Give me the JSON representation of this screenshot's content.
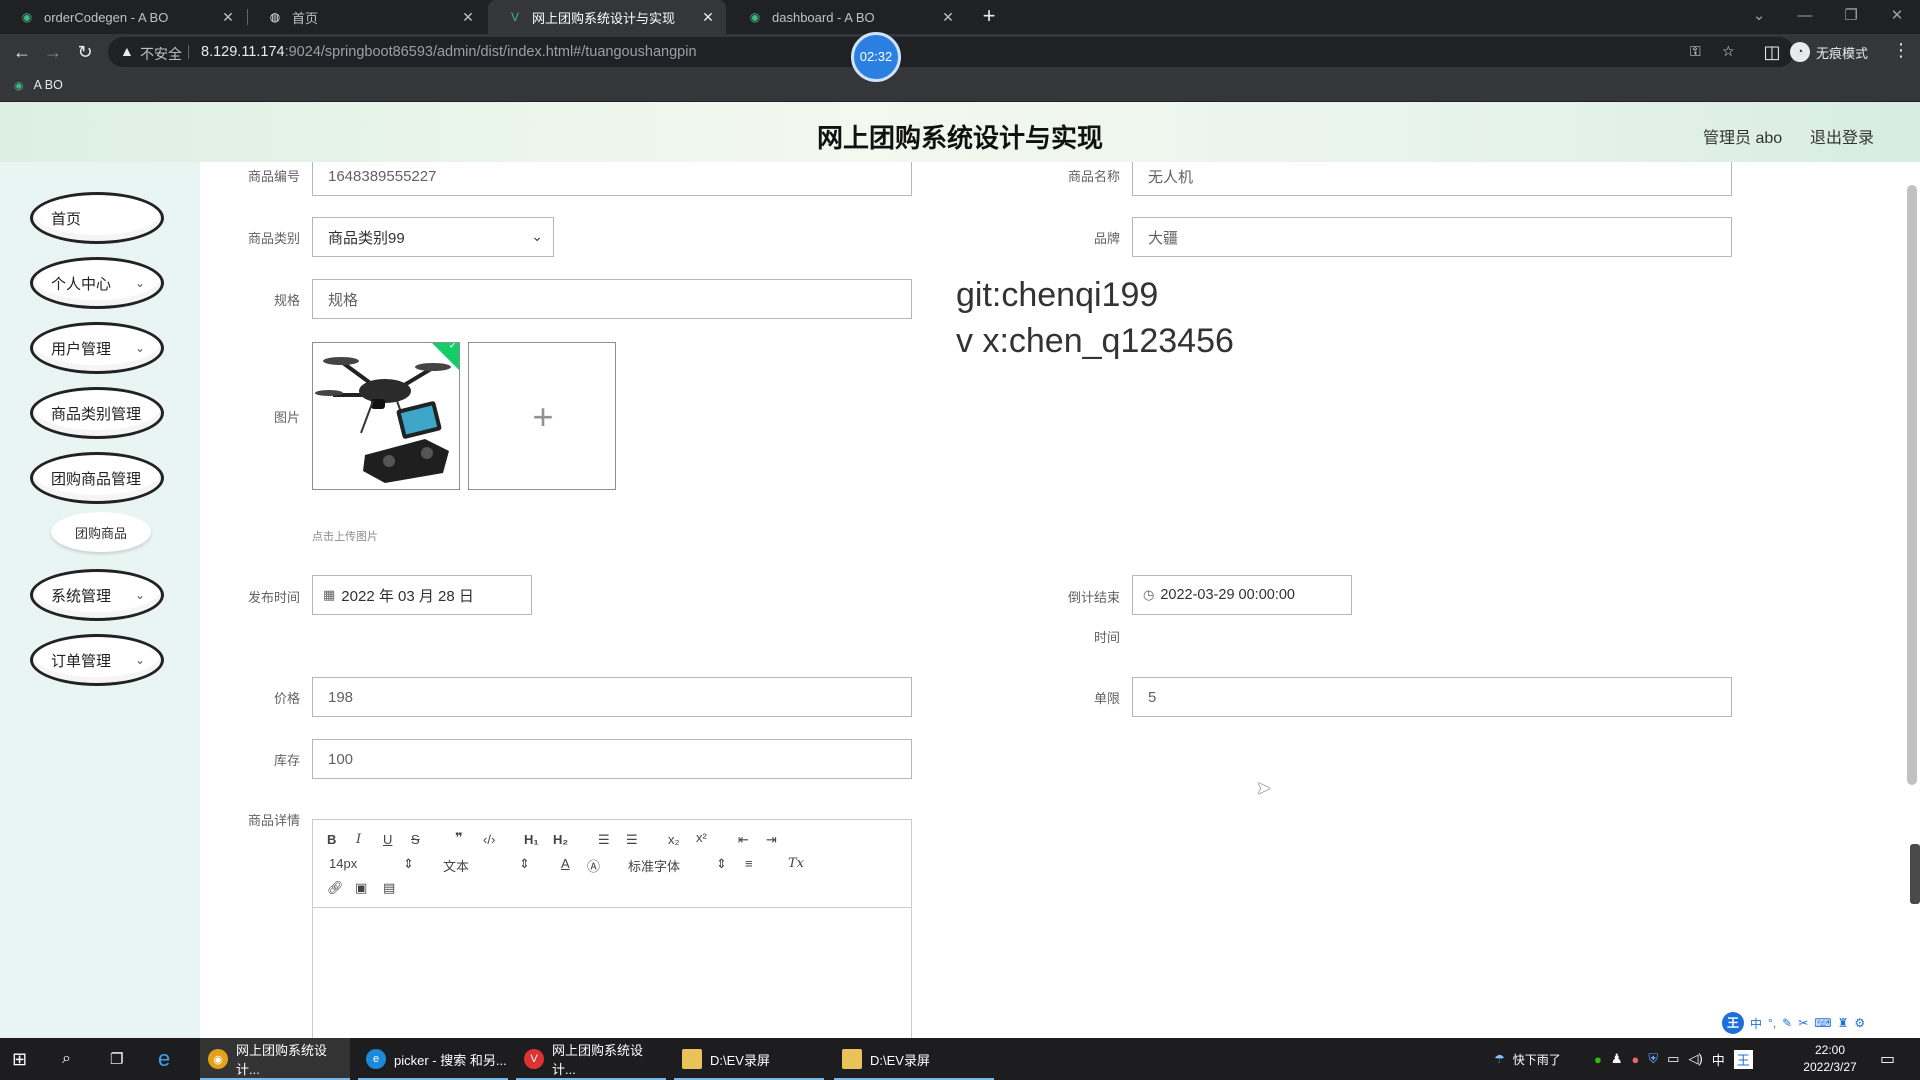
{
  "browser": {
    "tabs": [
      {
        "label": "orderCodegen - A BO"
      },
      {
        "label": "首页"
      },
      {
        "label": "网上团购系统设计与实现"
      },
      {
        "label": "dashboard - A BO"
      }
    ],
    "insecure_label": "不安全",
    "url_host": "8.129.11.174",
    "url_rest": ":9024/springboot86593/admin/dist/index.html#/tuangoushangpin",
    "incognito_label": "无痕模式",
    "bookmark_label": "A BO",
    "timer": "02:32"
  },
  "header": {
    "title": "网上团购系统设计与实现",
    "admin_label": "管理员 abo",
    "logout_label": "退出登录"
  },
  "sidebar": {
    "items": [
      {
        "label": "首页"
      },
      {
        "label": "个人中心"
      },
      {
        "label": "用户管理"
      },
      {
        "label": "商品类别管理"
      },
      {
        "label": "团购商品管理"
      },
      {
        "label": "团购商品"
      },
      {
        "label": "系统管理"
      },
      {
        "label": "订单管理"
      }
    ]
  },
  "form": {
    "product_no_label": "商品编号",
    "product_no_value": "1648389555227",
    "product_name_label": "商品名称",
    "product_name_value": "无人机",
    "category_label": "商品类别",
    "category_value": "商品类别99",
    "brand_label": "品牌",
    "brand_value": "大疆",
    "spec_label": "规格",
    "spec_placeholder": "规格",
    "image_label": "图片",
    "upload_tip": "点击上传图片",
    "publish_time_label": "发布时间",
    "publish_time_value": "2022 年 03 月 28 日",
    "countdown_label_1": "倒计结束",
    "countdown_label_2": "时间",
    "countdown_value": "2022-03-29 00:00:00",
    "price_label": "价格",
    "price_value": "198",
    "limit_label": "单限",
    "limit_value": "5",
    "stock_label": "库存",
    "stock_value": "100",
    "detail_label": "商品详情"
  },
  "watermark": {
    "line1": "git:chenqi199",
    "line2": "v x:chen_q123456"
  },
  "editor": {
    "size_select": "14px",
    "header_select": "文本",
    "font_select": "标准字体"
  },
  "taskbar": {
    "items": [
      {
        "label": "网上团购系统设计..."
      },
      {
        "label": "picker - 搜索 和另..."
      },
      {
        "label": "网上团购系统设计..."
      },
      {
        "label": "D:\\EV录屏"
      },
      {
        "label": "D:\\EV录屏"
      }
    ],
    "weather": "快下雨了",
    "ime_lang": "中",
    "time": "22:00",
    "date": "2022/3/27"
  }
}
